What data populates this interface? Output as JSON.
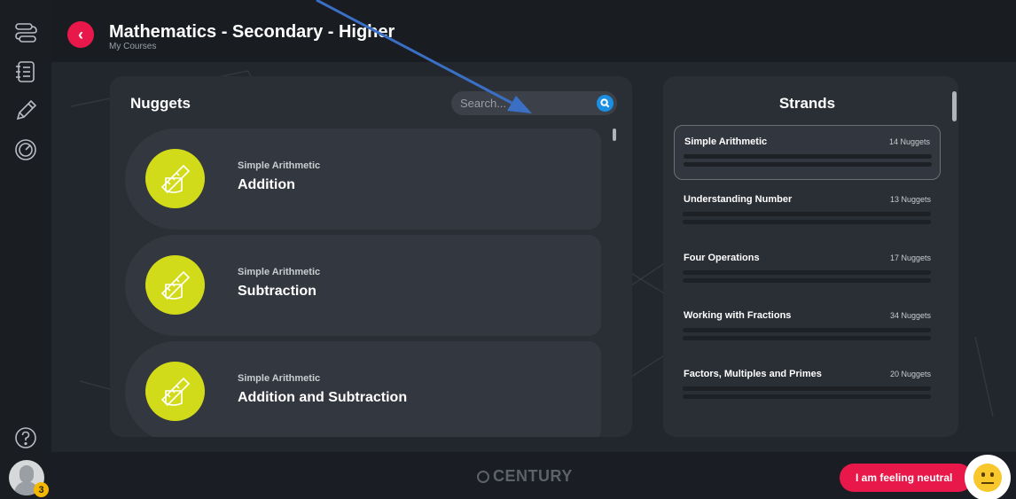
{
  "header": {
    "title": "Mathematics - Secondary - Higher",
    "subtitle": "My Courses"
  },
  "rail": {
    "icons": [
      "courses-icon",
      "notebook-icon",
      "pencil-icon",
      "dashboard-gauge-icon"
    ],
    "help_icon": "question-mark-icon",
    "notification_count": "3"
  },
  "nuggets": {
    "title": "Nuggets",
    "search_placeholder": "Search...",
    "items": [
      {
        "strand": "Simple Arithmetic",
        "name": "Addition"
      },
      {
        "strand": "Simple Arithmetic",
        "name": "Subtraction"
      },
      {
        "strand": "Simple Arithmetic",
        "name": "Addition and Subtraction"
      }
    ]
  },
  "strands": {
    "title": "Strands",
    "items": [
      {
        "name": "Simple Arithmetic",
        "count": "14 Nuggets",
        "selected": true
      },
      {
        "name": "Understanding Number",
        "count": "13 Nuggets",
        "selected": false
      },
      {
        "name": "Four Operations",
        "count": "17 Nuggets",
        "selected": false
      },
      {
        "name": "Working with Fractions",
        "count": "34 Nuggets",
        "selected": false
      },
      {
        "name": "Factors, Multiples and Primes",
        "count": "20 Nuggets",
        "selected": false
      }
    ]
  },
  "footer": {
    "logo": "CENTURY",
    "mood_label": "I am feeling neutral"
  },
  "colors": {
    "accent": "#e8194a",
    "badge": "#d2db1a",
    "search_button": "#1a8fe3",
    "annotation_arrow": "#3a6fc4"
  }
}
